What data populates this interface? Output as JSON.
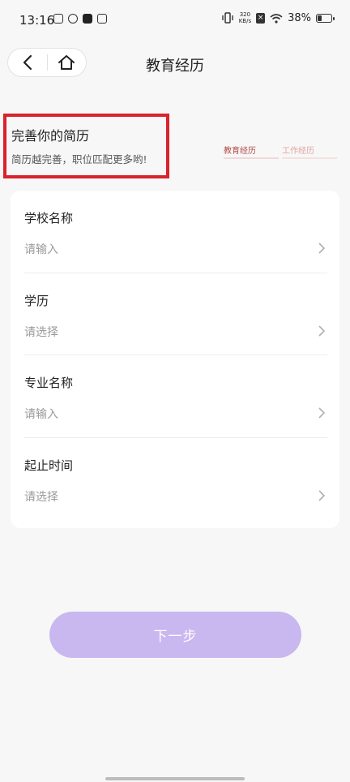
{
  "status_bar": {
    "time": "13:16",
    "net_speed_value": "320",
    "net_speed_unit": "KB/s",
    "battery": "38%"
  },
  "nav": {
    "back_icon": "chevron-left-icon",
    "home_icon": "home-icon",
    "title": "教育经历"
  },
  "intro": {
    "title": "完善你的简历",
    "subtitle": "简历越完善，职位匹配更多哟!"
  },
  "steps": [
    {
      "label": "教育经历",
      "active": true
    },
    {
      "label": "工作经历",
      "active": false
    }
  ],
  "form": {
    "fields": [
      {
        "label": "学校名称",
        "placeholder": "请输入"
      },
      {
        "label": "学历",
        "placeholder": "请选择"
      },
      {
        "label": "专业名称",
        "placeholder": "请输入"
      },
      {
        "label": "起止时间",
        "placeholder": "请选择"
      }
    ]
  },
  "next_button": "下一步",
  "colors": {
    "accent_button": "#c9b7f0",
    "highlight_border": "#d9232d",
    "step_active": "#b44848"
  }
}
